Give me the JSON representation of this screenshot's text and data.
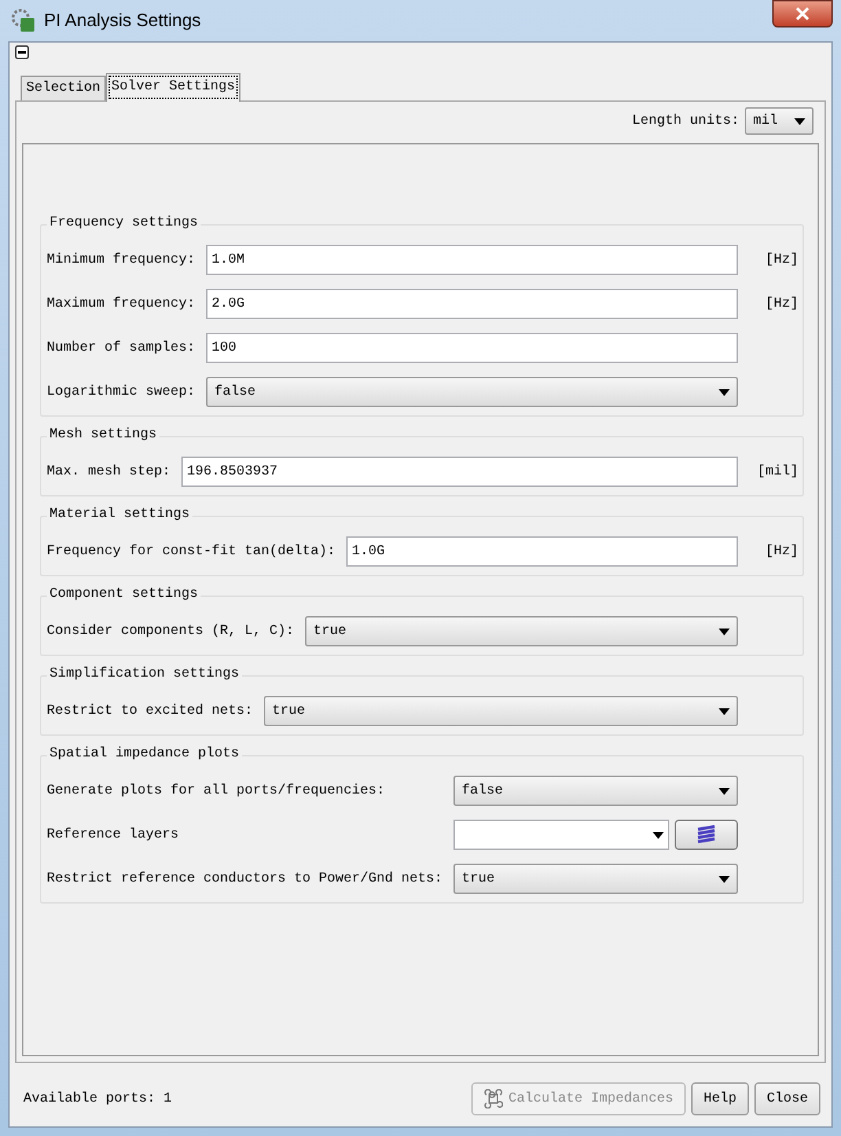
{
  "window": {
    "title": "PI Analysis Settings"
  },
  "tabs": [
    {
      "label": "Selection",
      "selected": false
    },
    {
      "label": "Solver Settings",
      "selected": true
    }
  ],
  "length_units": {
    "label": "Length units:",
    "value": "mil"
  },
  "groups": [
    {
      "title": "Frequency settings",
      "fields": [
        {
          "kind": "text",
          "label": "Minimum frequency:",
          "value": "1.0M",
          "unit": "[Hz]"
        },
        {
          "kind": "text",
          "label": "Maximum frequency:",
          "value": "2.0G",
          "unit": "[Hz]"
        },
        {
          "kind": "text",
          "label": "Number of samples:",
          "value": "100"
        },
        {
          "kind": "select",
          "label": "Logarithmic sweep:",
          "value": "false"
        }
      ]
    },
    {
      "title": "Mesh settings",
      "fields": [
        {
          "kind": "text",
          "label": "Max. mesh step:",
          "value": "196.8503937",
          "unit": "[mil]"
        }
      ]
    },
    {
      "title": "Material settings",
      "fields": [
        {
          "kind": "text",
          "label": "Frequency for const-fit tan(delta):",
          "value": "1.0G",
          "unit": "[Hz]"
        }
      ]
    },
    {
      "title": "Component settings",
      "fields": [
        {
          "kind": "select",
          "label": "Consider components (R, L, C):",
          "value": "true"
        }
      ]
    },
    {
      "title": "Simplification settings",
      "fields": [
        {
          "kind": "select",
          "label": "Restrict to excited nets:",
          "value": "true"
        }
      ]
    },
    {
      "title": "Spatial impedance plots",
      "fields": [
        {
          "kind": "select",
          "label": "Generate plots for all ports/frequencies:",
          "value": "false"
        },
        {
          "kind": "combo-button",
          "label": "Reference layers"
        },
        {
          "kind": "select",
          "label": "Restrict reference conductors to Power/Gnd nets:",
          "value": "true"
        }
      ]
    }
  ],
  "status": "Available ports: 1",
  "buttons": [
    {
      "label": "Calculate Impedances",
      "disabled": true
    },
    {
      "label": "Help",
      "disabled": false
    },
    {
      "label": "Close",
      "disabled": false
    }
  ]
}
